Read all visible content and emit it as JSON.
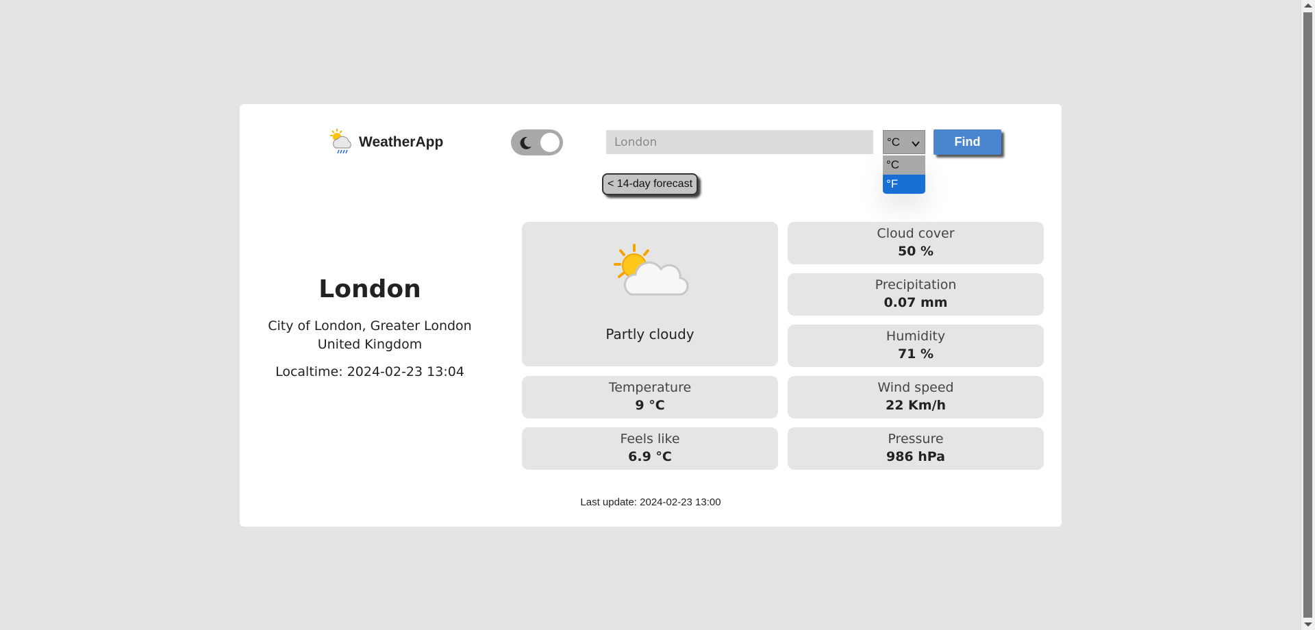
{
  "app": {
    "name": "WeatherApp"
  },
  "header": {
    "search": {
      "placeholder": "London",
      "value": ""
    },
    "unit_select": {
      "selected": "°C",
      "options": [
        "°C",
        "°F"
      ],
      "highlighted": "°F"
    },
    "find_label": "Find",
    "forecast_label": "< 14-day forecast",
    "theme": "light"
  },
  "location": {
    "city": "London",
    "region": "City of London, Greater London",
    "country": "United Kingdom",
    "localtime": "Localtime: 2024-02-23 13:04"
  },
  "condition": {
    "text": "Partly cloudy",
    "icon": "partly-cloudy-icon"
  },
  "stats": {
    "cloud_cover": {
      "label": "Cloud cover",
      "value": "50 %"
    },
    "precipitation": {
      "label": "Precipitation",
      "value": "0.07 mm"
    },
    "humidity": {
      "label": "Humidity",
      "value": "71 %"
    },
    "temperature": {
      "label": "Temperature",
      "value": "9 °C"
    },
    "wind_speed": {
      "label": "Wind speed",
      "value": "22 Km/h"
    },
    "feels_like": {
      "label": "Feels like",
      "value": "6.9 °C"
    },
    "pressure": {
      "label": "Pressure",
      "value": "986 hPa"
    }
  },
  "footer": {
    "last_update": "Last update: 2024-02-23 13:00"
  },
  "colors": {
    "page_bg": "#e4e4e4",
    "card_bg": "#ffffff",
    "tile_bg": "#e5e5e5",
    "find_button": "#4a86cf",
    "option_highlight": "#1a6fd6",
    "toggle_bg": "#a9a9a9"
  }
}
